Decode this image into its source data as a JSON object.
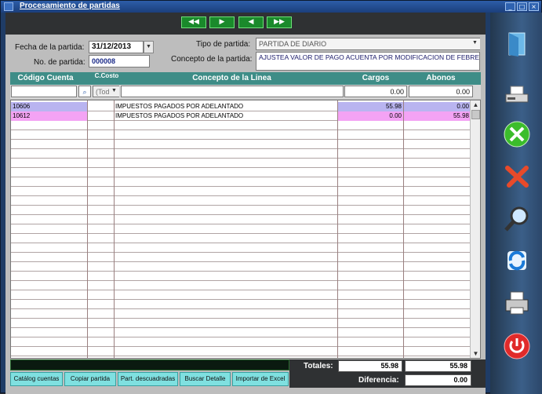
{
  "window": {
    "title": "Procesamiento de partidas"
  },
  "nav": {
    "first": "◀◀",
    "next": "▶",
    "prev": "◀",
    "last": "▶▶"
  },
  "form": {
    "fecha_label": "Fecha de la partida:",
    "fecha_value": "31/12/2013",
    "no_label": "No. de partida:",
    "no_value": "000008",
    "tipo_label": "Tipo de partida:",
    "tipo_value": "PARTIDA  DE DIARIO",
    "concepto_label": "Concepto de la partida:",
    "concepto_value": "AJUSTEA VALOR DE PAGO ACUENTA POR MODIFICACION DE FEBRERO"
  },
  "grid": {
    "headers": [
      "Código Cuenta",
      "C.Costo",
      "Concepto de la Linea",
      "Cargos",
      "Abonos"
    ],
    "filter": {
      "costo": "(Tod",
      "cargos": "0.00",
      "abonos": "0.00"
    },
    "rows": [
      {
        "codigo": "10606",
        "costo": "",
        "concepto": "IMPUESTOS PAGADOS POR ADELANTADO",
        "cargos": "55.98",
        "abonos": "0.00"
      },
      {
        "codigo": "10612",
        "costo": "",
        "concepto": "IMPUESTOS PAGADOS POR ADELANTADO",
        "cargos": "0.00",
        "abonos": "55.98"
      }
    ]
  },
  "buttons": {
    "catalogo": "Catálog cuentas",
    "copiar": "Copiar partida",
    "descuadradas": "Part. descuadradas",
    "buscar": "Buscar Detalle",
    "excel": "Importar de Excel"
  },
  "totals": {
    "totales_label": "Totales:",
    "cargos": "55.98",
    "abonos": "55.98",
    "diferencia_label": "Diferencia:",
    "diferencia": "0.00"
  },
  "colors": {
    "header": "#3e8d87",
    "row1": "#b9b4f0",
    "row2": "#f4a3f4",
    "nav": "#1a8a2b",
    "button": "#7fe0e0"
  },
  "icons": [
    "folder-icon",
    "scanner-icon",
    "tools-icon",
    "delete-icon",
    "search-icon",
    "refresh-icon",
    "printer-icon",
    "power-icon"
  ]
}
